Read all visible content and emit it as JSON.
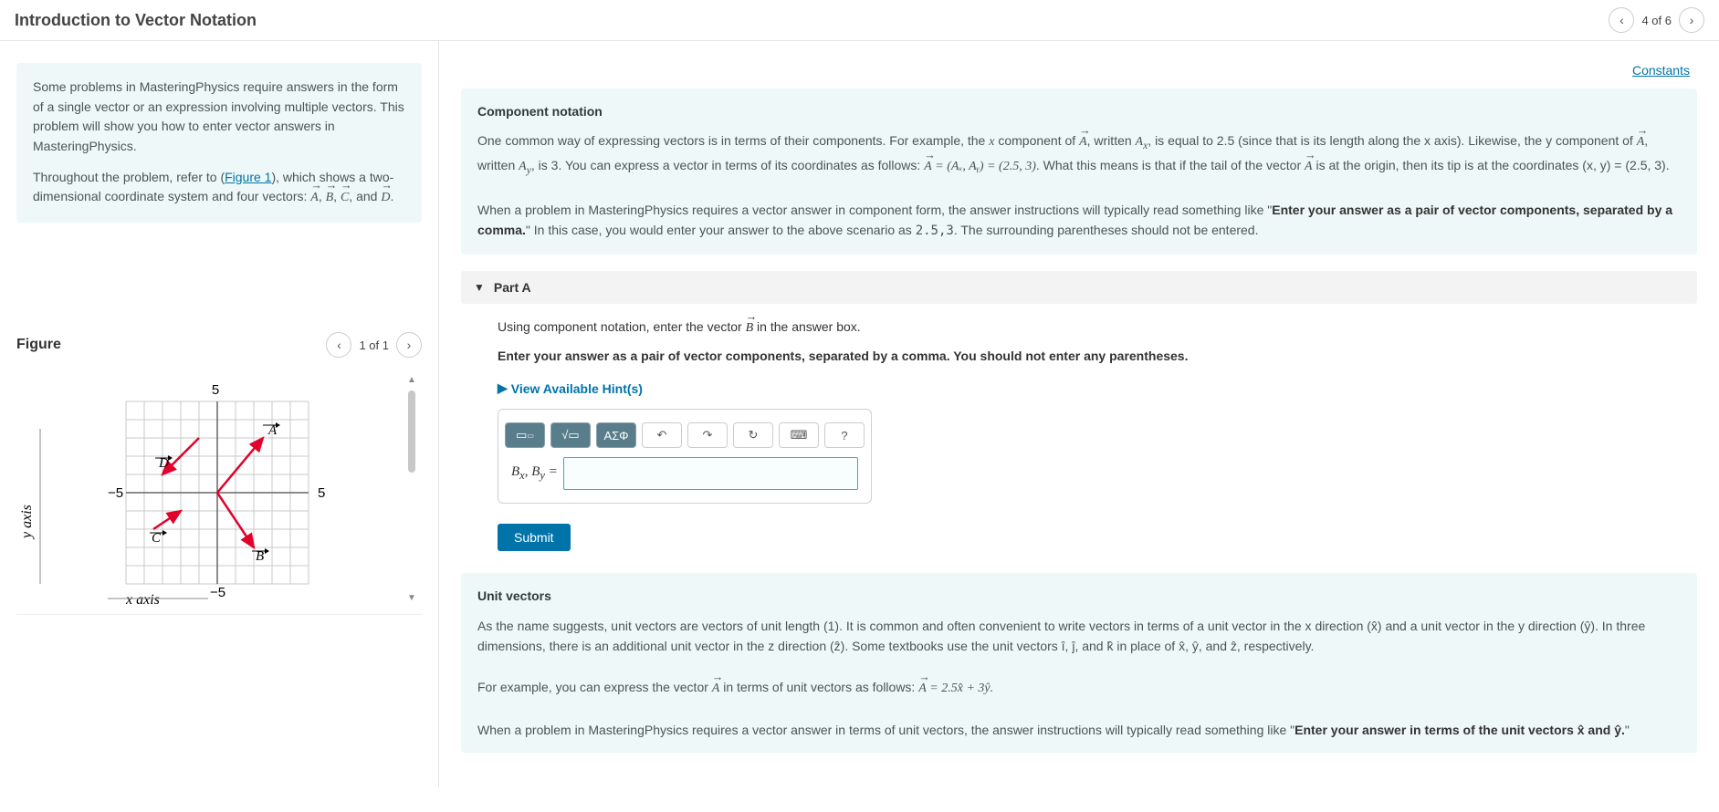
{
  "chart_data": {
    "type": "scatter",
    "title": "",
    "xlabel": "x axis",
    "ylabel": "y axis",
    "xlim": [
      -5,
      5
    ],
    "ylim": [
      -5,
      5
    ],
    "tick_labels": {
      "x": [
        "-5",
        "5"
      ],
      "y": [
        "-5",
        "5"
      ]
    },
    "series": [
      {
        "name": "A",
        "type": "vector",
        "start": [
          0,
          0
        ],
        "end": [
          2.5,
          3
        ]
      },
      {
        "name": "B",
        "type": "vector",
        "start": [
          0,
          0
        ],
        "end": [
          2,
          -3
        ]
      },
      {
        "name": "C",
        "type": "vector",
        "start": [
          -3.5,
          -2
        ],
        "end": [
          -2,
          -1
        ]
      },
      {
        "name": "D",
        "type": "vector",
        "start": [
          -1,
          3
        ],
        "end": [
          -3,
          1
        ]
      }
    ]
  },
  "header": {
    "title": "Introduction to Vector Notation",
    "progress_label": "4 of 6"
  },
  "intro": {
    "p1": "Some problems in MasteringPhysics require answers in the form of a single vector or an expression involving multiple vectors. This problem will show you how to enter vector answers in MasteringPhysics.",
    "figure_link": "Figure 1",
    "vectors": [
      "A",
      "B",
      "C",
      "D"
    ]
  },
  "figure": {
    "title": "Figure",
    "counter": "1 of 1",
    "x_axis_label": "x axis",
    "y_axis_label": "y axis",
    "ticks": {
      "pos": "5",
      "neg": "-5",
      "neg_y": "−5"
    }
  },
  "links": {
    "constants": "Constants"
  },
  "component": {
    "heading": "Component notation",
    "p1_lead": "One common way of expressing vectors is in terms of their components. For example, the ",
    "xcomp_label": "x component of",
    "written": ", written",
    "Ax_text": ", is equal to 2.5 (since that is its length along the x axis). Likewise, the y component of",
    "Ay_text": ", is 3. You can express a vector in terms of its coordinates as follows:",
    "equation": " = (Aₓ, Aᵧ) = (2.5, 3)",
    "tail": ". What this means is that if the tail of the vector ",
    "origin": " is at the origin, then its tip is at the coordinates (x, y) = (2.5, 3).",
    "p2": "When a problem in MasteringPhysics requires a vector answer in component form, the answer instructions will typically read something like \"",
    "bold_instr": "Enter your answer as a pair of vector components, separated by a comma.",
    "p2b": "\" In this case, you would enter your answer to the above scenario as ",
    "ans_example": "2.5,3",
    "p2c": ". The surrounding parentheses should not be entered."
  },
  "part_a": {
    "label": "Part A",
    "prompt_lead": "Using component notation, enter the vector ",
    "prompt_vec": "B",
    "prompt_tail": " in the answer box.",
    "instruction": "Enter your answer as a pair of vector components, separated by a comma. You should not enter any parentheses.",
    "hints": "View Available Hint(s)",
    "input_label_html": "Bₓ, Bᵧ =",
    "submit": "Submit",
    "toolbar": {
      "template_icon": "template-icon",
      "sqrt_icon": "sqrt-x-icon",
      "greek": "ΑΣΦ",
      "undo": "undo-icon",
      "redo": "redo-icon",
      "reset": "reset-icon",
      "keyboard": "keyboard-icon",
      "help": "?"
    }
  },
  "unit": {
    "heading": "Unit vectors",
    "p1": "As the name suggests, unit vectors are vectors of unit length (1). It is common and often convenient to write vectors in terms of a unit vector in the x direction (x̂) and a unit vector in the y direction (ŷ). In three dimensions, there is an additional unit vector in the z direction (ẑ). Some textbooks use the unit vectors î, ĵ, and k̂ in place of x̂, ŷ, and ẑ, respectively.",
    "p2_lead": "For example, you can express the vector ",
    "eq": " in terms of unit vectors as follows: ",
    "eq_rhs": " = 2.5x̂ + 3ŷ.",
    "p3": "When a problem in MasteringPhysics requires a vector answer in terms of unit vectors, the answer instructions will typically read something like \"",
    "bold2": "Enter your answer in terms of the unit vectors x̂ and ŷ.",
    "p3b": "\""
  }
}
